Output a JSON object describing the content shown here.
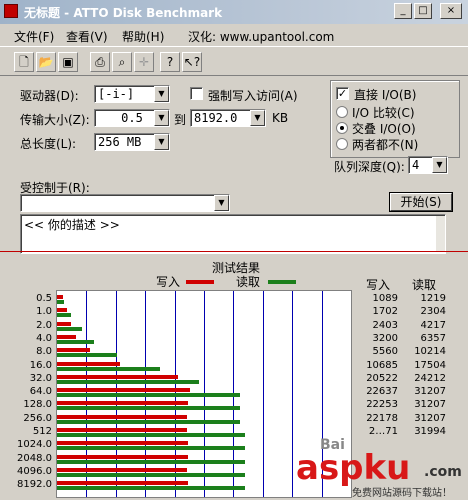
{
  "window": {
    "title": "无标题 - ATTO Disk Benchmark"
  },
  "titlebar_buttons": {
    "minimize": "_",
    "maximize": "□",
    "close": "×"
  },
  "menu": [
    {
      "label": "文件(F)"
    },
    {
      "label": "查看(V)"
    },
    {
      "label": "帮助(H)"
    },
    {
      "label": "汉化: www.upantool.com"
    }
  ],
  "toolbar_icons": [
    "new-file-icon",
    "open-folder-icon",
    "save-icon",
    "print-icon",
    "print-preview-icon",
    "move-icon",
    "help-icon",
    "context-help-icon"
  ],
  "form": {
    "drive_label": "驱动器(D):",
    "drive_value": "[-i-]",
    "force_write_label": "强制写入访问(A)",
    "direct_io_label": "直接 I/O(B)",
    "direct_io_checked": true,
    "transfer_label": "传输大小(Z):",
    "transfer_from": "0.5",
    "to_label": "到",
    "transfer_to": "8192.0",
    "unit": "KB",
    "io_compare_label": "I/O 比较(C)",
    "overlapped_label": "交叠 I/O(O)",
    "neither_label": "两者都不(N)",
    "total_length_label": "总长度(L):",
    "total_length_value": "256 MB",
    "queue_depth_label": "队列深度(Q):",
    "queue_depth_value": "4",
    "controlled_by_label": "受控制于(R):",
    "controlled_by_value": "",
    "start_button": "开始(S)",
    "description": "<<  你的描述  >>"
  },
  "results": {
    "title": "测试结果",
    "legend_write": "写入",
    "legend_read": "读取",
    "col_write": "写入",
    "col_read": "读取",
    "write_color": "#d00000",
    "read_color": "#1b7f1b"
  },
  "chart_data": {
    "type": "bar",
    "title": "测试结果",
    "categories": [
      "0.5",
      "1.0",
      "2.0",
      "4.0",
      "8.0",
      "16.0",
      "32.0",
      "64.0",
      "128.0",
      "256.0",
      "512",
      "1024.0",
      "2048.0",
      "4096.0",
      "8192.0"
    ],
    "series": [
      {
        "name": "写入",
        "values": [
          1089,
          1702,
          2403,
          3200,
          5560,
          10685,
          20522,
          22637,
          22253,
          22178,
          22171,
          22200,
          22200,
          22150,
          22200
        ],
        "labels": [
          "1089",
          "1702",
          "2403",
          "3200",
          "5560",
          "10685",
          "20522",
          "22637",
          "22253",
          "22178",
          "2…71",
          "",
          "",
          "",
          ""
        ]
      },
      {
        "name": "读取",
        "values": [
          1219,
          2304,
          4217,
          6357,
          10214,
          17504,
          24212,
          31207,
          31207,
          31207,
          31994,
          31994,
          31994,
          31994,
          31994
        ],
        "labels": [
          "1219",
          "2304",
          "4217",
          "6357",
          "10214",
          "17504",
          "24212",
          "31207",
          "31207",
          "31207",
          "31994",
          "",
          "",
          "",
          ""
        ]
      }
    ],
    "xlim": [
      0,
      50000
    ],
    "grid": true
  },
  "watermark": {
    "brand": "aspku",
    "suffix": ".com",
    "caption": "免费网站源码下载站！",
    "small": "Bai"
  }
}
